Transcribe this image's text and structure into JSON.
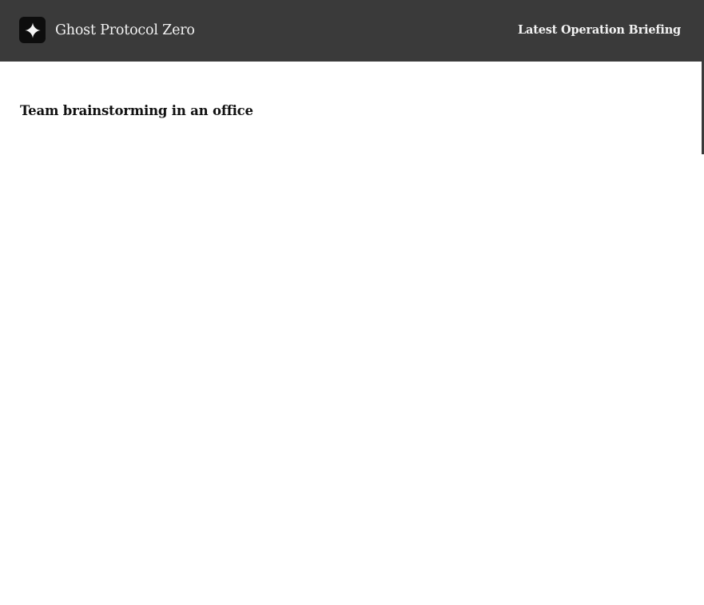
{
  "header": {
    "logo_icon": "sparkle-icon",
    "site_title": "Ghost Protocol Zero",
    "nav_link": "Latest Operation Briefing"
  },
  "main": {
    "title": "Team brainstorming in an office"
  },
  "colors": {
    "header_bg": "#3a3a3a",
    "header_text": "#f2f2f2",
    "page_bg": "#ffffff",
    "body_text": "#111111"
  }
}
